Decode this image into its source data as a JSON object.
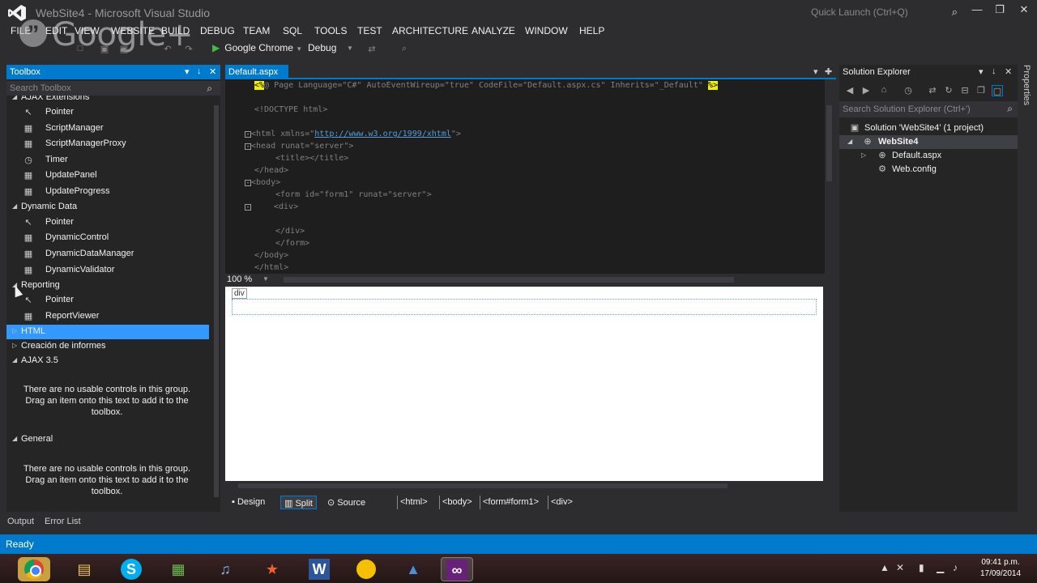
{
  "window": {
    "title": "WebSite4 - Microsoft Visual Studio",
    "quick_launch_placeholder": "Quick Launch (Ctrl+Q)"
  },
  "menu": [
    "FILE",
    "EDIT",
    "VIEW",
    "WEBSITE",
    "BUILD",
    "DEBUG",
    "TEAM",
    "SQL",
    "TOOLS",
    "TEST",
    "ARCHITECTURE",
    "ANALYZE",
    "WINDOW",
    "HELP"
  ],
  "watermark": {
    "text": "Google+"
  },
  "toolbar": {
    "run_label": "Google Chrome",
    "config_label": "Debug"
  },
  "toolbox": {
    "title": "Toolbox",
    "search_placeholder": "Search Toolbox",
    "rows": [
      {
        "kind": "group-partial",
        "label": "AJAX Extensions"
      },
      {
        "kind": "item",
        "label": "Pointer",
        "icon": "pointer-icon"
      },
      {
        "kind": "item",
        "label": "ScriptManager",
        "icon": "control-icon"
      },
      {
        "kind": "item",
        "label": "ScriptManagerProxy",
        "icon": "control-icon"
      },
      {
        "kind": "item",
        "label": "Timer",
        "icon": "timer-icon"
      },
      {
        "kind": "item",
        "label": "UpdatePanel",
        "icon": "control-icon"
      },
      {
        "kind": "item",
        "label": "UpdateProgress",
        "icon": "control-icon"
      },
      {
        "kind": "group",
        "label": "Dynamic Data"
      },
      {
        "kind": "item",
        "label": "Pointer",
        "icon": "pointer-icon"
      },
      {
        "kind": "item",
        "label": "DynamicControl",
        "icon": "control-icon"
      },
      {
        "kind": "item",
        "label": "DynamicDataManager",
        "icon": "control-icon"
      },
      {
        "kind": "item",
        "label": "DynamicValidator",
        "icon": "control-icon"
      },
      {
        "kind": "group",
        "label": "Reporting"
      },
      {
        "kind": "item",
        "label": "Pointer",
        "icon": "pointer-icon"
      },
      {
        "kind": "item",
        "label": "ReportViewer",
        "icon": "control-icon"
      },
      {
        "kind": "group-collapsed-selected",
        "label": "HTML"
      },
      {
        "kind": "group-collapsed",
        "label": "Creación de informes"
      },
      {
        "kind": "group",
        "label": "AJAX 3.5"
      },
      {
        "kind": "group",
        "label": "General"
      }
    ],
    "empty_message_lines": [
      "There are no usable controls in this group.",
      "Drag an item onto this text to add it to the",
      "toolbox."
    ]
  },
  "editor": {
    "tab_label": "Default.aspx",
    "zoom": "100 %",
    "lines": [
      {
        "y": 0,
        "html_key": "l1"
      },
      {
        "y": 1,
        "html_key": "l2"
      }
    ],
    "code": {
      "l1_a": "<%@ Page Language=\"C#\" AutoEventWireup=\"true\" CodeFile=\"Default.aspx.cs\" Inherits=\"_Default\" %>",
      "l2": "<!DOCTYPE html>",
      "l3_a": "<html xmlns=\"",
      "l3_link": "http://www.w3.org/1999/xhtml",
      "l3_b": "\">",
      "l4": "<head runat=\"server\">",
      "l5": "<title></title>",
      "l6": "</head>",
      "l7": "<body>",
      "l8": "<form id=\"form1\" runat=\"server\">",
      "l9": "<div>",
      "l10": "</div>",
      "l11": "</form>",
      "l12": "</body>",
      "l13": "</html>"
    },
    "design_tag": "div"
  },
  "view_bar": {
    "design": "Design",
    "split": "Split",
    "source": "Source",
    "crumbs": [
      "<html>",
      "<body>",
      "<form#form1>",
      "<div>"
    ]
  },
  "bottom_tabs": [
    "Output",
    "Error List"
  ],
  "status": "Ready",
  "solution_explorer": {
    "title": "Solution Explorer",
    "search_placeholder": "Search Solution Explorer (Ctrl+')",
    "solution_label": "Solution 'WebSite4' (1 project)",
    "project_label": "WebSite4",
    "files": [
      "Default.aspx",
      "Web.config"
    ],
    "properties_tab": "Properties"
  },
  "taskbar": {
    "time": "09:41 p.m.",
    "date": "17/09/2014"
  }
}
